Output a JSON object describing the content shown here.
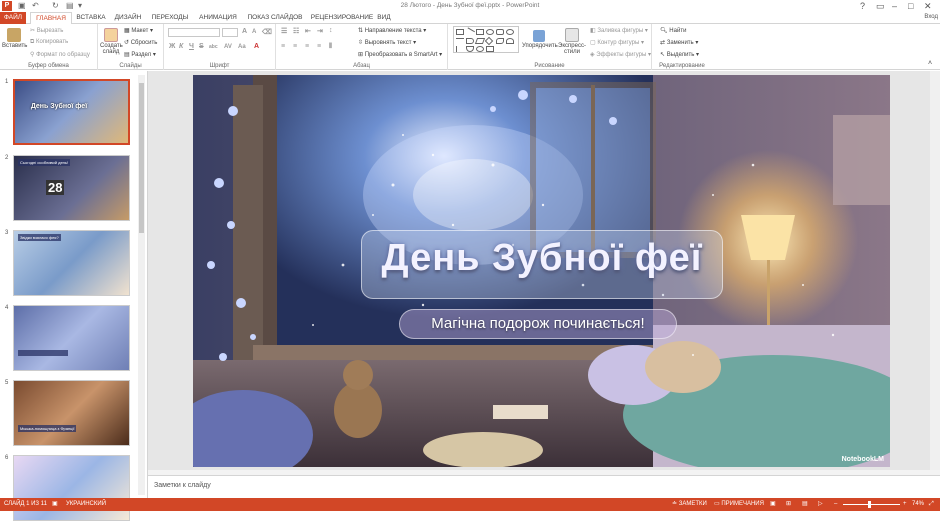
{
  "window": {
    "title": "28 Лютого - День Зубної феї.pptx - PowerPoint",
    "app_icon": "P",
    "signin": "Вход"
  },
  "tabs": [
    "ФАЙЛ",
    "ГЛАВНАЯ",
    "ВСТАВКА",
    "ДИЗАЙН",
    "ПЕРЕХОДЫ",
    "АНИМАЦИЯ",
    "ПОКАЗ СЛАЙДОВ",
    "РЕЦЕНЗИРОВАНИЕ",
    "ВИД"
  ],
  "ribbon": {
    "clipboard": {
      "paste": "Вставить",
      "cut": "Вырезать",
      "copy": "Копировать",
      "format_painter": "Формат по образцу",
      "label": "Буфер обмена"
    },
    "slides": {
      "new_slide": "Создать слайд",
      "layout": "Макет",
      "reset": "Сбросить",
      "section": "Раздел",
      "label": "Слайды"
    },
    "font": {
      "label": "Шрифт",
      "bold": "Ж",
      "italic": "К",
      "underline": "Ч",
      "strike": "S",
      "shadow": "abc",
      "case": "Aa",
      "grow": "A",
      "shrink": "A"
    },
    "paragraph": {
      "text_direction": "Направление текста",
      "align_text": "Выровнять текст",
      "smartart": "Преобразовать в SmartArt",
      "label": "Абзац"
    },
    "drawing": {
      "arrange": "Упорядочить",
      "quick_styles": "Экспресс-стили",
      "shape_fill": "Заливка фигуры",
      "shape_outline": "Контур фигуры",
      "shape_effects": "Эффекты фигуры",
      "label": "Рисование"
    },
    "editing": {
      "find": "Найти",
      "replace": "Заменить",
      "select": "Выделить",
      "label": "Редактирование"
    }
  },
  "thumbnails": [
    {
      "num": "1",
      "title": "День Зубної феї",
      "bg": "#3a4a7a"
    },
    {
      "num": "2",
      "title": "Сьогодні особливий день!",
      "bg": "#2b3150",
      "calendar": "28"
    },
    {
      "num": "3",
      "title": "Звідки взялася фея?",
      "bg": "#8fb0d6"
    },
    {
      "num": "4",
      "title": "",
      "bg": "#7e92c8"
    },
    {
      "num": "5",
      "title": "Мышка-помощница з Франції",
      "bg": "#8a5a3a"
    },
    {
      "num": "6",
      "title": "",
      "bg": "#c3b2e0"
    }
  ],
  "slide": {
    "title": "День Зубної феї",
    "subtitle": "Магічна подорож починається!",
    "watermark": "NotebookLM"
  },
  "notes_placeholder": "Заметки к слайду",
  "status": {
    "slide_info": "СЛАЙД 1 ИЗ 11",
    "language": "УКРАИНСКИЙ",
    "notes": "ЗАМЕТКИ",
    "comments": "ПРИМЕЧАНИЯ",
    "zoom": "74%"
  },
  "colors": {
    "accent": "#d24726"
  }
}
